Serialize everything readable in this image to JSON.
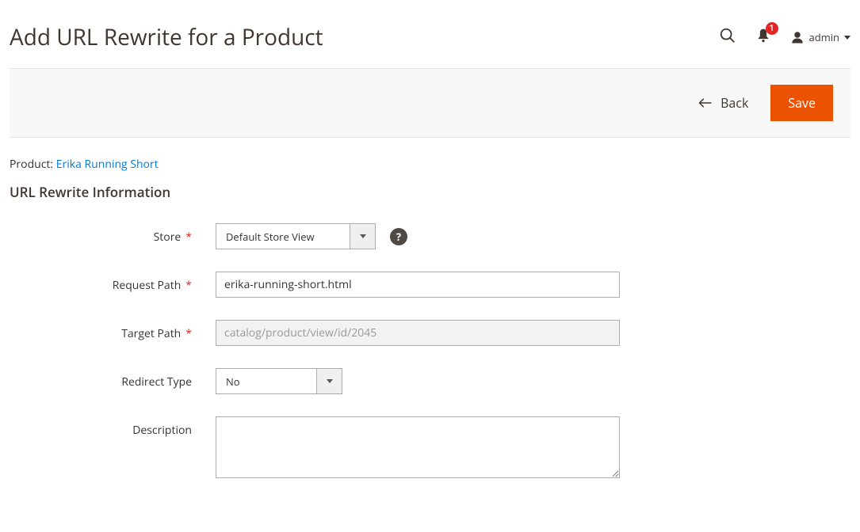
{
  "header": {
    "title": "Add URL Rewrite for a Product",
    "notification_count": "1",
    "user_name": "admin"
  },
  "actionbar": {
    "back_label": "Back",
    "save_label": "Save"
  },
  "product": {
    "prefix": "Product: ",
    "name": "Erika Running Short"
  },
  "section_title": "URL Rewrite Information",
  "form": {
    "store": {
      "label": "Store",
      "value": "Default Store View"
    },
    "request_path": {
      "label": "Request Path",
      "value": "erika-running-short.html"
    },
    "target_path": {
      "label": "Target Path",
      "value": "catalog/product/view/id/2045"
    },
    "redirect_type": {
      "label": "Redirect Type",
      "value": "No"
    },
    "description": {
      "label": "Description",
      "value": ""
    }
  }
}
